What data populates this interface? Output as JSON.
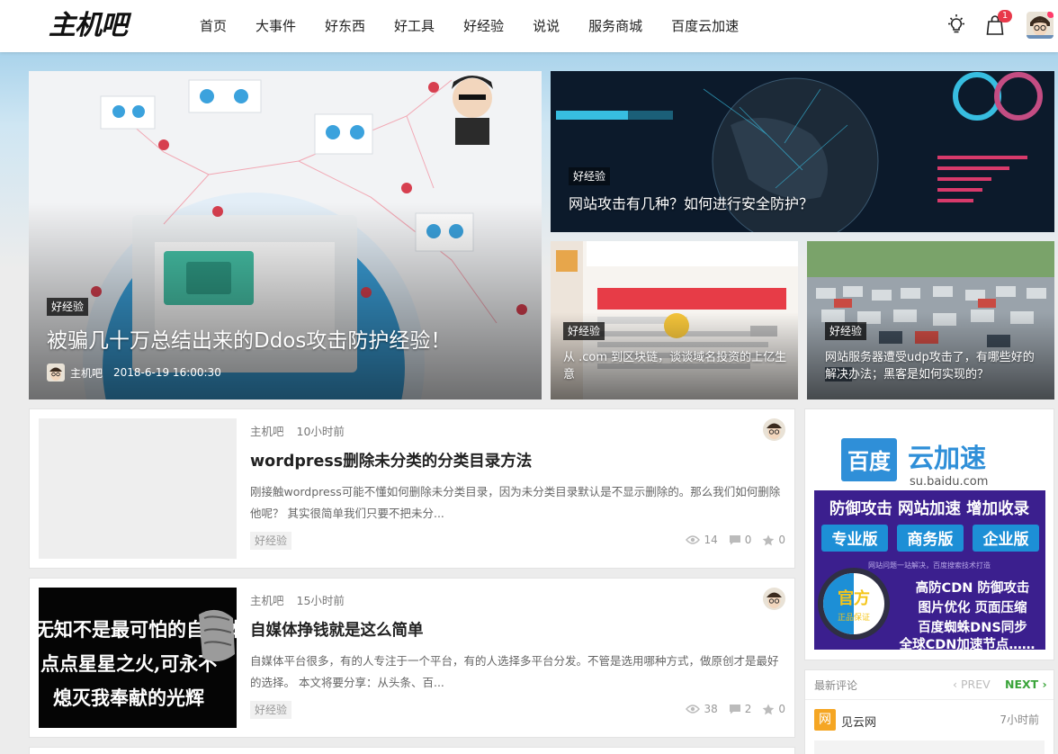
{
  "site": {
    "logo": "主机吧"
  },
  "nav": [
    {
      "label": "首页"
    },
    {
      "label": "大事件"
    },
    {
      "label": "好东西"
    },
    {
      "label": "好工具"
    },
    {
      "label": "好经验"
    },
    {
      "label": "说说"
    },
    {
      "label": "服务商城"
    },
    {
      "label": "百度云加速"
    }
  ],
  "header": {
    "cart_count": "1"
  },
  "hero": {
    "main": {
      "tag": "好经验",
      "title": "被骗几十万总结出来的Ddos攻击防护经验！",
      "author": "主机吧",
      "datetime": "2018-6-19 16:00:30"
    },
    "top_right": {
      "tag": "好经验",
      "title": "网站攻击有几种？如何进行安全防护？"
    },
    "bottom_mid": {
      "tag": "好经验",
      "title": "从 .com 到区块链，谈谈域名投资的上亿生意"
    },
    "bottom_right": {
      "tag": "好经验",
      "title": "网站服务器遭受udp攻击了，有哪些好的解决办法；黑客是如何实现的？"
    }
  },
  "posts": [
    {
      "author": "主机吧",
      "time": "10小时前",
      "title": "wordpress删除未分类的分类目录方法",
      "excerpt": "刚接触wordpress可能不懂如何删除未分类目录，因为未分类目录默认是不显示删除的。那么我们如何删除他呢？ 其实很简单我们只要不把未分...",
      "tag": "好经验",
      "views": "14",
      "comments": "0",
      "likes": "0"
    },
    {
      "author": "主机吧",
      "time": "15小时前",
      "title": "自媒体挣钱就是这么简单",
      "excerpt": "自媒体平台很多，有的人专注于一个平台，有的人选择多平台分发。不管是选用哪种方式，做原创才是最好的选择。 本文将要分享：从头条、百...",
      "tag": "好经验",
      "views": "38",
      "comments": "2",
      "likes": "0",
      "thumb_lines": [
        "无知不是最可怕的自媒体人",
        "点点星星之火,可永不",
        "熄灭我奉献的光辉"
      ]
    }
  ],
  "ad": {
    "brand_left": "百度",
    "brand_right": "云加速",
    "domain": "su.baidu.com",
    "headline": "防御攻击 网站加速 增加收录",
    "editions": [
      "专业版",
      "商务版",
      "企业版"
    ],
    "slogan": "网站问题一站解决，百度搜索技术打造",
    "badge_top": "官方",
    "badge_bottom": "正品保证",
    "features": [
      "高防CDN 防御攻击",
      "图片优化 页面压缩",
      "百度蜘蛛DNS同步",
      "全球CDN加速节点……"
    ]
  },
  "comments_widget": {
    "heading": "最新评论",
    "prev": "‹ PREV",
    "next": "NEXT ›",
    "item": {
      "logo": "网",
      "name": "见云网",
      "time": "7小时前"
    }
  },
  "icons": [
    "lightbulb-icon",
    "shopping-bag-icon",
    "eye-icon",
    "comment-icon",
    "star-icon"
  ],
  "colors": {
    "accent_green": "#3aa43a",
    "badge_red": "#e8394a",
    "ad_purple": "#3b1f8e",
    "ad_blue": "#1d8fd6"
  }
}
